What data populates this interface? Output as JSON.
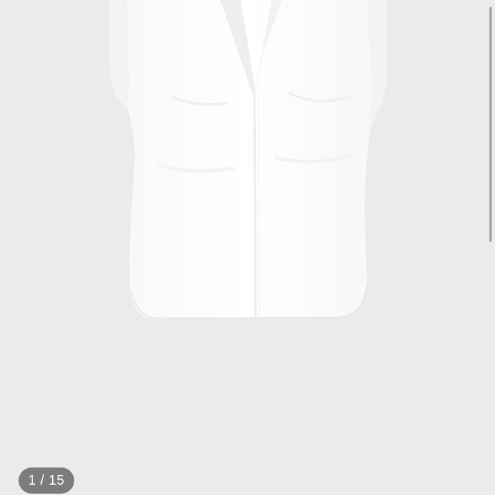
{
  "gallery": {
    "page_counter": "1 / 15",
    "current_index": 1,
    "total_images": 15,
    "product_image_icon": "white-sleeveless-shirt-image",
    "scroll_indicator_icon": "vertical-scrollbar"
  },
  "colors": {
    "background": "#ebebeb",
    "shirt": "#ffffff",
    "counter_badge": "#7c7c7c",
    "counter_text": "#ffffff"
  }
}
